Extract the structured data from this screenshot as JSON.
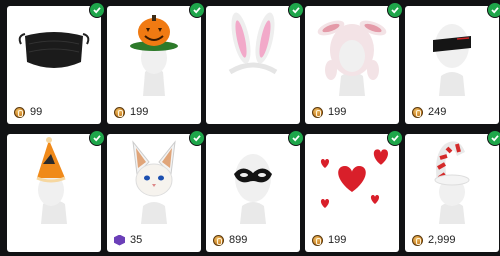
{
  "catalog": {
    "items": [
      {
        "icon": "black-face-mask-icon",
        "currency": "coin-icon",
        "price": "99",
        "owned": true
      },
      {
        "icon": "pumpkin-hat-icon",
        "currency": "coin-icon",
        "price": "199",
        "owned": true
      },
      {
        "icon": "bunny-ears-headband-icon",
        "currency": "coin-icon",
        "price": "",
        "owned": true
      },
      {
        "icon": "lamb-hood-icon",
        "currency": "coin-icon",
        "price": "199",
        "owned": true
      },
      {
        "icon": "eye-patch-blindfold-icon",
        "currency": "coin-icon",
        "price": "249",
        "owned": true
      },
      {
        "icon": "party-hat-icon",
        "currency": "coin-icon",
        "price": "",
        "owned": true
      },
      {
        "icon": "white-cat-head-icon",
        "currency": "token-icon",
        "price": "35",
        "owned": true
      },
      {
        "icon": "masquerade-mask-icon",
        "currency": "coin-icon",
        "price": "899",
        "owned": true
      },
      {
        "icon": "floating-hearts-icon",
        "currency": "coin-icon",
        "price": "199",
        "owned": true
      },
      {
        "icon": "candy-cane-hat-icon",
        "currency": "coin-icon",
        "price": "2,999",
        "owned": true
      }
    ],
    "colors": {
      "background": "#111214",
      "card": "#ffffff",
      "owned_check": "#1ea64a",
      "coin": "#c47a1f",
      "token": "#6b3fb8"
    }
  }
}
